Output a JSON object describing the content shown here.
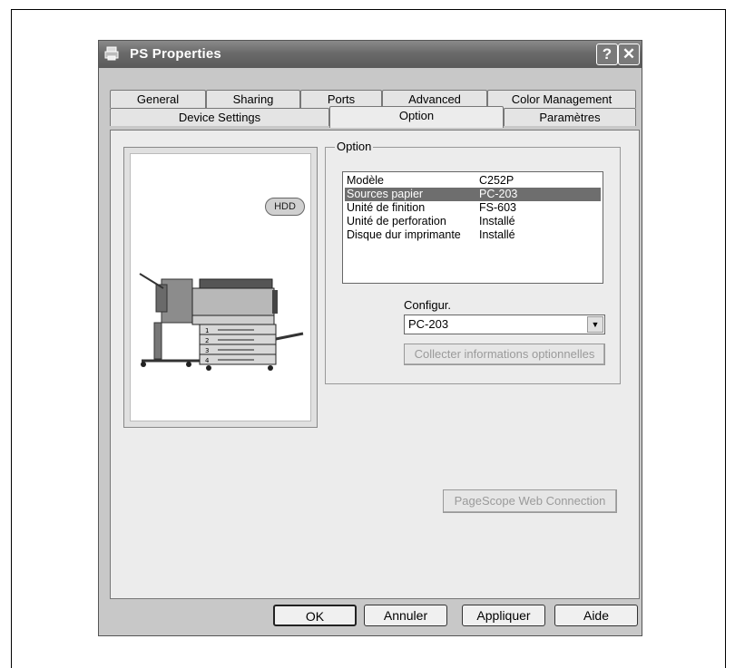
{
  "window": {
    "title": "PS Properties",
    "help_glyph": "?",
    "close_glyph": "✕"
  },
  "tabs_row1": [
    "General",
    "Sharing",
    "Ports",
    "Advanced",
    "Color Management"
  ],
  "tabs_row2": [
    "Device Settings",
    "Option",
    "Paramètres"
  ],
  "active_tab": "Option",
  "preview": {
    "hdd_label": "HDD",
    "tray_numbers": [
      "1",
      "2",
      "3",
      "4"
    ]
  },
  "option_group": {
    "label": "Option",
    "items": [
      {
        "name": "Modèle",
        "value": "C252P",
        "selected": false
      },
      {
        "name": "Sources papier",
        "value": "PC-203",
        "selected": true
      },
      {
        "name": "Unité de finition",
        "value": "FS-603",
        "selected": false
      },
      {
        "name": "Unité de perforation",
        "value": "Installé",
        "selected": false
      },
      {
        "name": "Disque dur imprimante",
        "value": "Installé",
        "selected": false
      }
    ],
    "config_label": "Configur.",
    "config_value": "PC-203",
    "collect_button": "Collecter informations optionnelles"
  },
  "webconnection_button": "PageScope Web Connection",
  "buttons": {
    "ok": "OK",
    "cancel": "Annuler",
    "apply": "Appliquer",
    "help": "Aide"
  }
}
